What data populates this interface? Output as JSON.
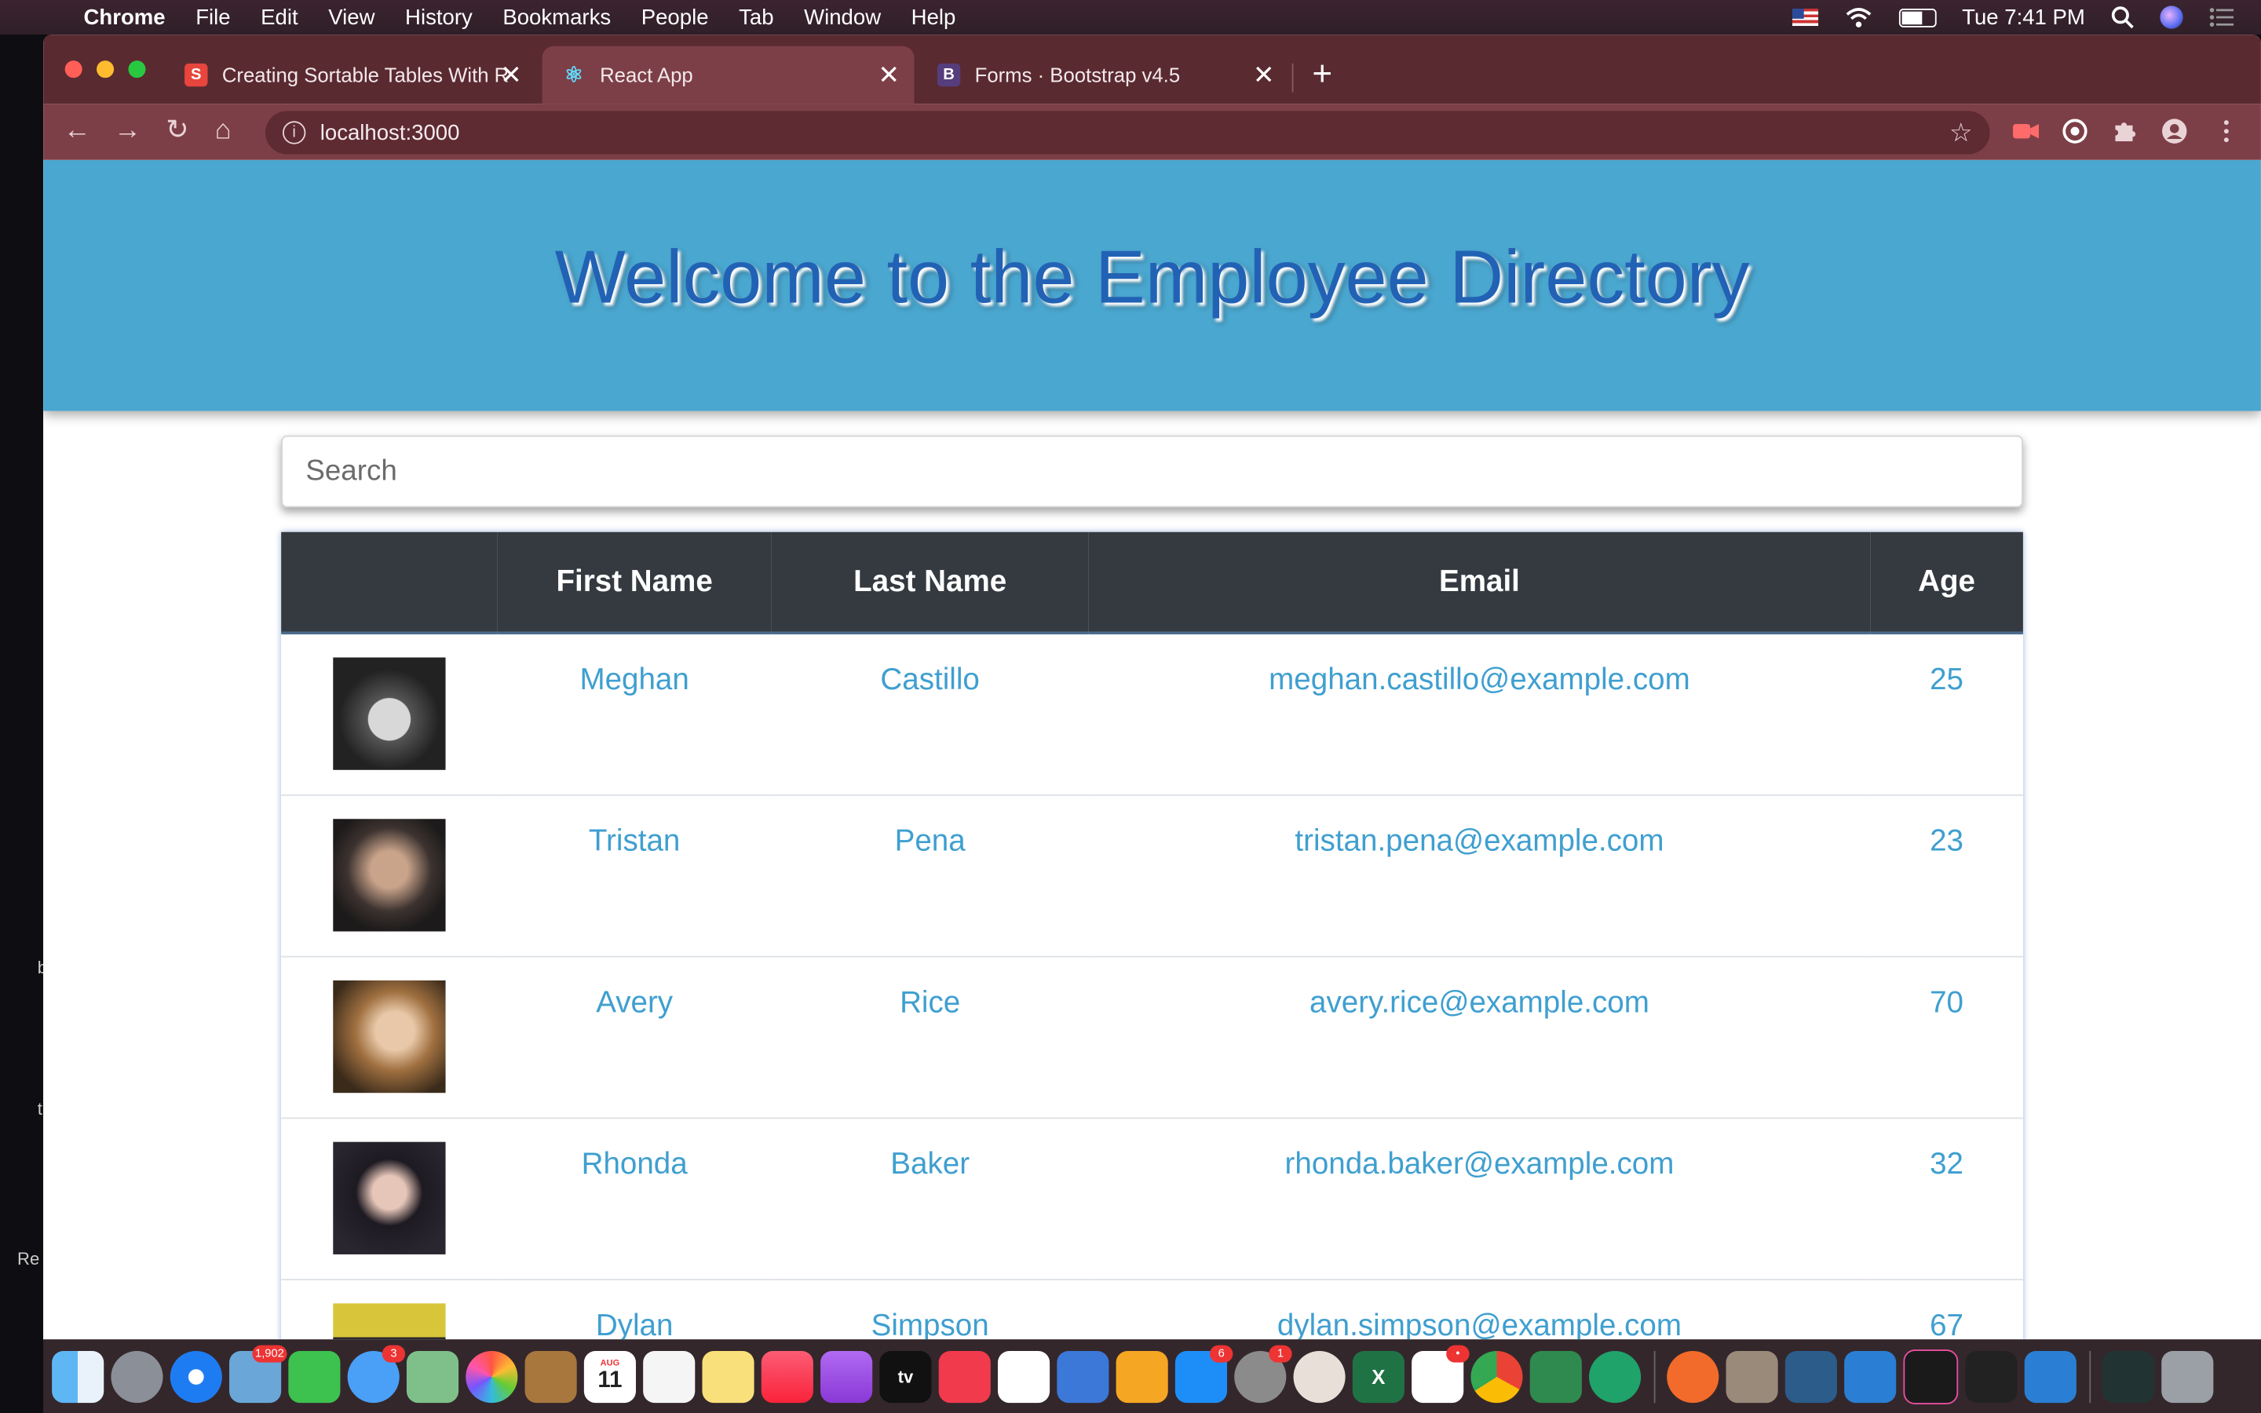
{
  "menubar": {
    "apple": "",
    "items": [
      "Chrome",
      "File",
      "Edit",
      "View",
      "History",
      "Bookmarks",
      "People",
      "Tab",
      "Window",
      "Help"
    ],
    "clock": "Tue 7:41 PM"
  },
  "desktop": {
    "fragments": [
      "b",
      "t",
      "Re"
    ]
  },
  "browser": {
    "tabs": [
      {
        "title": "Creating Sortable Tables With R",
        "favicon_letter": "S",
        "favicon_color": "#e8453c"
      },
      {
        "title": "React App",
        "favicon_letter": "⚛",
        "favicon_color": "#61dafb"
      },
      {
        "title": "Forms · Bootstrap v4.5",
        "favicon_letter": "B",
        "favicon_color": "#563d7c"
      }
    ],
    "new_tab": "+",
    "close_glyph": "✕",
    "url": "localhost:3000",
    "nav": {
      "back": "←",
      "forward": "→",
      "reload": "↻",
      "home": "⌂"
    },
    "star": "☆",
    "info": "i"
  },
  "page": {
    "heading": "Welcome to the Employee Directory",
    "search_placeholder": "Search",
    "table": {
      "headers": [
        "",
        "First Name",
        "Last Name",
        "Email",
        "Age"
      ],
      "rows": [
        {
          "first": "Meghan",
          "last": "Castillo",
          "email": "meghan.castillo@example.com",
          "age": "25",
          "avatar": "#333333"
        },
        {
          "first": "Tristan",
          "last": "Pena",
          "email": "tristan.pena@example.com",
          "age": "23",
          "avatar": "#5b4a3d"
        },
        {
          "first": "Avery",
          "last": "Rice",
          "email": "avery.rice@example.com",
          "age": "70",
          "avatar": "#7b5a3a"
        },
        {
          "first": "Rhonda",
          "last": "Baker",
          "email": "rhonda.baker@example.com",
          "age": "32",
          "avatar": "#2b2630"
        },
        {
          "first": "Dylan",
          "last": "Simpson",
          "email": "dylan.simpson@example.com",
          "age": "67",
          "avatar": "#d9c53a"
        }
      ]
    }
  },
  "dock": {
    "badges": {
      "mail": "1,902",
      "messages": "3",
      "appstore": "6",
      "settings": "1",
      "slack": "•"
    },
    "calendar_day": "11",
    "calendar_month": "AUG",
    "appletv": "tv",
    "excel": "X"
  }
}
